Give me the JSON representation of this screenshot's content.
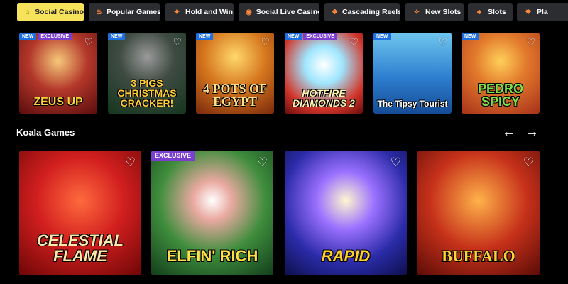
{
  "tabs": [
    {
      "label": "Social Casino",
      "icon": "house-icon",
      "glyph": "⌂",
      "active": true
    },
    {
      "label": "Popular Games",
      "icon": "flame-icon",
      "glyph": "♨",
      "active": false
    },
    {
      "label": "Hold and Win",
      "icon": "dynamite-icon",
      "glyph": "✦",
      "active": false
    },
    {
      "label": "Social Live Casino",
      "icon": "live-dealer-icon",
      "glyph": "◉",
      "active": false
    },
    {
      "label": "Cascading Reels",
      "icon": "cascade-icon",
      "glyph": "❖",
      "active": false
    },
    {
      "label": "New Slots",
      "icon": "sparkle-icon",
      "glyph": "✧",
      "active": false
    },
    {
      "label": "Slots",
      "icon": "cherries-icon",
      "glyph": "♣",
      "active": false
    },
    {
      "label": "Pla",
      "icon": "star-icon",
      "glyph": "✸",
      "active": false
    }
  ],
  "small_games": [
    {
      "title": "ZEUS UP",
      "badges": [
        "NEW",
        "EXCLUSIVE"
      ]
    },
    {
      "title": "3 PIGS CHRISTMAS CRACKER!",
      "badges": [
        "NEW"
      ]
    },
    {
      "title": "4 POTS OF EGYPT",
      "badges": [
        "NEW"
      ]
    },
    {
      "title": "HOTFIRE DIAMONDS 2",
      "badges": [
        "NEW",
        "EXCLUSIVE"
      ]
    },
    {
      "title": "The Tipsy Tourist",
      "badges": [
        "NEW"
      ]
    },
    {
      "title": "PEDRO SPICY",
      "badges": [
        "NEW"
      ]
    }
  ],
  "section": {
    "title": "Koala Games",
    "prev_icon": "←",
    "next_icon": "→"
  },
  "big_games": [
    {
      "title": "CELESTIAL FLAME",
      "badges": []
    },
    {
      "title": "ELFIN' RICH",
      "badges": [
        "EXCLUSIVE"
      ]
    },
    {
      "title": "RAPID",
      "badges": []
    },
    {
      "title": "BUFFALO",
      "badges": []
    }
  ],
  "favorite_icon": "♡"
}
